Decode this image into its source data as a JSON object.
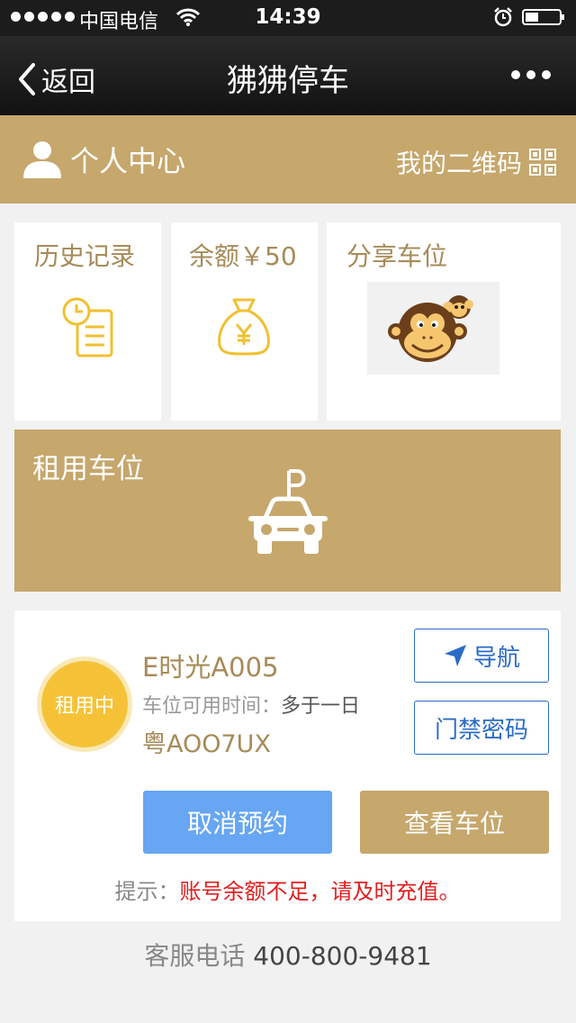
{
  "status_bar": {
    "carrier": "中国电信",
    "time": "14:39",
    "battery_level": 0.4
  },
  "nav": {
    "back_label": "返回",
    "title": "狒狒停车"
  },
  "user_bar": {
    "title": "个人中心",
    "qr_label": "我的二维码"
  },
  "cards": {
    "history": "历史记录",
    "balance": "余额￥50",
    "share": "分享车位"
  },
  "rent": {
    "label": "租用车位"
  },
  "order": {
    "status": "租用中",
    "parking_name": "E时光A005",
    "available_label": "车位可用时间：",
    "available_value": "多于一日",
    "plate": "粤AOO7UX",
    "navigate_label": "导航",
    "door_code_label": "门禁密码",
    "cancel_label": "取消预约",
    "view_label": "查看车位",
    "tip_prefix": "提示：",
    "tip_text": "账号余额不足，请及时充值。"
  },
  "service": {
    "label": "客服电话",
    "phone": "400-800-9481"
  },
  "colors": {
    "gold": "#c6a76c",
    "blue_button": "#66a6f2",
    "link_blue": "#2a6bc6",
    "badge_yellow": "#f5c237",
    "warning_red": "#e02020"
  }
}
